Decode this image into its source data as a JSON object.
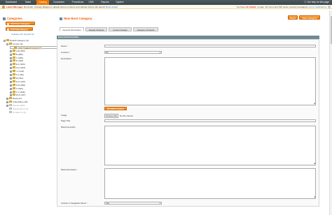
{
  "topnav": {
    "items": [
      "Dashboard",
      "Sales",
      "Catalog",
      "Customers",
      "Promotions",
      "CMS",
      "Reports",
      "System"
    ],
    "active_index": 2,
    "help": "Get help for this page"
  },
  "notice": {
    "prefix": "Latest Message:",
    "message": "Reminder: Change Magento's default phone numbers and callouts before site launch",
    "read_details": "Read details",
    "summary_pre": "You have",
    "critical": "10 critical",
    "major": "4 major",
    "minor": "30 minor",
    "notice_count": "198 notice",
    "summary_post": "unread message(s).",
    "go": "Go to notifications",
    "close": "x"
  },
  "sidebar": {
    "title": "Categories",
    "add_root": "Add Root Category",
    "add_sub": "Add Subcategory",
    "collapse_all": "Collapse All",
    "separator": "|",
    "expand_all": "Expand All",
    "tree": [
      {
        "label": "Default Category (0)",
        "toggle": "-",
        "style": ""
      },
      {
        "label": "Comics (0)",
        "toggle": "-",
        "style": ""
      },
      {
        "label": "CGC Graded Comics (7)",
        "toggle": "",
        "style": "sel"
      },
      {
        "label": "A-B (252)",
        "toggle": "+",
        "style": ""
      },
      {
        "label": "B (365)",
        "toggle": "+",
        "style": ""
      },
      {
        "label": "C (295)",
        "toggle": "+",
        "style": ""
      },
      {
        "label": "D (336)",
        "toggle": "+",
        "style": ""
      },
      {
        "label": "E-F (320)",
        "toggle": "+",
        "style": ""
      },
      {
        "label": "G-H (315)",
        "toggle": "+",
        "style": ""
      },
      {
        "label": "I-J (144)",
        "toggle": "+",
        "style": ""
      },
      {
        "label": "K-L (86)",
        "toggle": "+",
        "style": ""
      },
      {
        "label": "M (312)",
        "toggle": "+",
        "style": ""
      },
      {
        "label": "N-O (207)",
        "toggle": "+",
        "style": ""
      },
      {
        "label": "P-R (290)",
        "toggle": "+",
        "style": ""
      },
      {
        "label": "S (515)",
        "toggle": "+",
        "style": ""
      },
      {
        "label": "T-V (268)",
        "toggle": "+",
        "style": ""
      },
      {
        "label": "W-Z (107)",
        "toggle": "+",
        "style": ""
      },
      {
        "label": "Books (0)",
        "toggle": "+",
        "style": ""
      },
      {
        "label": "Collectibles (36)",
        "toggle": "+",
        "style": ""
      },
      {
        "label": "Games (683)",
        "toggle": "+",
        "style": "gray"
      },
      {
        "label": "Subscriptions (0)",
        "toggle": "",
        "style": "gray"
      },
      {
        "label": "Contact Us (0)",
        "toggle": "",
        "style": "gray"
      }
    ]
  },
  "main": {
    "title": "New Root Category",
    "reset": "Reset",
    "save": "Save Category",
    "tabs": [
      "General Information",
      "Display Settings",
      "Custom Design",
      "Category Products"
    ],
    "active_tab": 0,
    "section_title": "General Information",
    "fields": {
      "name_label": "Name",
      "is_active_label": "Is Active",
      "is_active_value": "No",
      "description_label": "Description",
      "wysiwyg": "WYSIWYG Editor",
      "image_label": "Image",
      "choose_file": "Choose File",
      "no_file": "No file chosen",
      "page_title_label": "Page Title",
      "meta_keywords_label": "Meta Keywords",
      "meta_description_label": "Meta Description",
      "include_nav_label": "Include in Navigation Menu",
      "include_nav_value": "Yes",
      "required_mark": "*"
    }
  },
  "colors": {
    "accent": "#eb5e00",
    "nav_bg": "#3f4a50",
    "section_bg": "#6f8992",
    "button": "#f18200"
  }
}
